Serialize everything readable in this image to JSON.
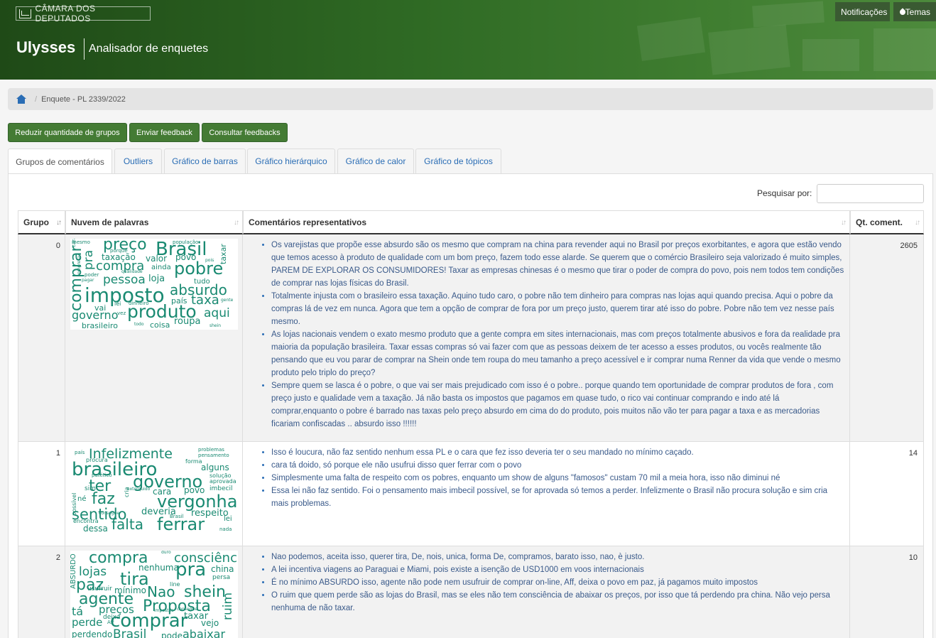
{
  "header": {
    "logo_text": "CÂMARA DOS DEPUTADOS",
    "app_title": "Ulysses",
    "app_subtitle": "Analisador de enquetes",
    "notifications_label": "Notificações",
    "themes_label": "Temas"
  },
  "breadcrumb": {
    "current": "Enquete - PL 2339/2022"
  },
  "actions": {
    "reduce_groups": "Reduzir quantidade de grupos",
    "send_feedback": "Enviar feedback",
    "view_feedbacks": "Consultar feedbacks"
  },
  "tabs": [
    {
      "label": "Grupos de comentários"
    },
    {
      "label": "Outliers"
    },
    {
      "label": "Gráfico de barras"
    },
    {
      "label": "Gráfico hierárquico"
    },
    {
      "label": "Gráfico de calor"
    },
    {
      "label": "Gráfico de tópicos"
    }
  ],
  "search": {
    "label": "Pesquisar por:",
    "value": ""
  },
  "table": {
    "headers": {
      "group": "Grupo",
      "cloud": "Nuvem de palavras",
      "comments": "Comentários representativos",
      "count": "Qt. coment."
    },
    "rows": [
      {
        "group": "0",
        "count": "2605",
        "comments": [
          "Os varejistas que propõe esse absurdo são os mesmo que compram na china para revender aqui no Brasil por preços exorbitantes, e agora que estão vendo que temos acesso à produto de qualidade com um bom preço, fazem todo esse alarde. Se querem que o comércio Brasileiro seja valorizado é muito simples, PAREM DE EXPLORAR OS CONSUMIDORES! Taxar as empresas chinesas é o mesmo que tirar o poder de compra do povo, pois nem todos tem condições de comprar nas lojas físicas do Brasil.",
          "Totalmente injusta com o brasileiro essa taxação. Aquino tudo caro, o pobre não tem dinheiro para compras nas lojas aqui quando precisa. Aqui o pobre da compras lá de vez em nunca. Agora que tem a opção de comprar de fora por um preço justo, querem tirar até isso do pobre. Pobre não tem vez nesse país mesmo.",
          "As lojas nacionais vendem o exato mesmo produto que a gente compra em sites internacionais, mas com preços totalmente abusivos e fora da realidade pra maioria da população brasileira. Taxar essas compras só vai fazer com que as pessoas deixem de ter acesso a esses produtos, ou vocês realmente tão pensando que eu vou parar de comprar na Shein onde tem roupa do meu tamanho a preço acessível e ir comprar numa Renner da vida que vende o mesmo produto pelo triplo do preço?",
          "Sempre quem se lasca é o pobre, o que vai ser mais prejudicado com isso é o pobre.. porque quando tem oportunidade de comprar produtos de fora , com preço justo e qualidade vem a taxação. Já não basta os impostos que pagamos em quase tudo, o rico vai continuar comprando e indo até lá comprar,enquanto o pobre é barrado nas taxas pelo preço absurdo em cima do do produto, pois muitos não vão ter para pagar a taxa e as mercadorias ficariam confiscadas .. absurdo isso !!!!!!"
        ],
        "cloud": [
          "preço",
          "Brasil",
          "comprar",
          "compra",
          "pobre",
          "taxação",
          "valor",
          "povo",
          "ainda",
          "pessoa",
          "loja",
          "imposto",
          "absurdo",
          "taxa",
          "produto",
          "aqui",
          "governo",
          "brasileiro",
          "coisa",
          "roupa",
          "pra",
          "taxar",
          "tudo",
          "país",
          "vai",
          "lei",
          "dinheiro",
          "população",
          "porque",
          "qualidade",
          "poder",
          "pagar",
          "todo",
          "shein",
          "gente",
          "pois",
          "empresa",
          "cara",
          "mesmo",
          "vez"
        ]
      },
      {
        "group": "1",
        "count": "14",
        "comments": [
          "Isso é loucura, não faz sentido nenhum essa PL e o cara que fez isso deveria ter o seu mandado no mínimo caçado.",
          "cara tá doido, só porque ele não usufrui disso quer ferrar com o povo",
          "Simplesmente uma falta de respeito com os pobres, enquanto um show de alguns \"famosos\" custam 70 mil a meia hora, isso não diminui né",
          "Essa lei não faz sentido. Foi o pensamento mais imbecil possível, se for aprovada só temos a perder. Infelizmente o Brasil não procura solução e sim cria mais problemas."
        ],
        "cloud": [
          "Infelizmente",
          "problemas",
          "pensamento",
          "brasileiro",
          "forma",
          "alguns",
          "governo",
          "ter",
          "solução",
          "aprovada",
          "imbecil",
          "cara",
          "povo",
          "faz",
          "vergonha",
          "sentido",
          "deveria",
          "respeito",
          "falta",
          "ferrar",
          "dessa",
          "nada",
          "lei",
          "Brasil",
          "encontra",
          "possível",
          "né",
          "sim",
          "país",
          "procura",
          "patético",
          "extorquido",
          "cria",
          "consegue"
        ]
      },
      {
        "group": "2",
        "count": "10",
        "comments": [
          "Nao podemos, aceita isso, querer tira, De, nois, unica, forma De, compramos, barato isso, nao, è justo.",
          "A lei incentiva viagens ao Paraguai e Miami, pois existe a isenção de USD1000 em voos internacionais",
          "É no mínimo ABSURDO isso, agente não pode nem usufruir de comprar on-line, Aff, deixa o povo em paz, já pagamos muito impostos",
          "O ruim que quem perde são as lojas do Brasil, mas se eles não tem consciência de abaixar os preços, por isso que tá perdendo pra china. Não vejo persa nenhuma de não taxar."
        ],
        "cloud": [
          "compra",
          "consciência",
          "pra",
          "lojas",
          "nenhuma",
          "china",
          "tira",
          "paz",
          "line",
          "Nao",
          "shein",
          "mínimo",
          "agente",
          "preços",
          "Proposta",
          "ruim",
          "comprar",
          "perde",
          "taxar",
          "vejo",
          "perdendo",
          "Brasil",
          "pode",
          "abaixar",
          "ABSURDO",
          "tá",
          "usufruir",
          "persa",
          "deixa",
          "Aff",
          "impostos",
          "consegue",
          "duro"
        ]
      }
    ]
  }
}
